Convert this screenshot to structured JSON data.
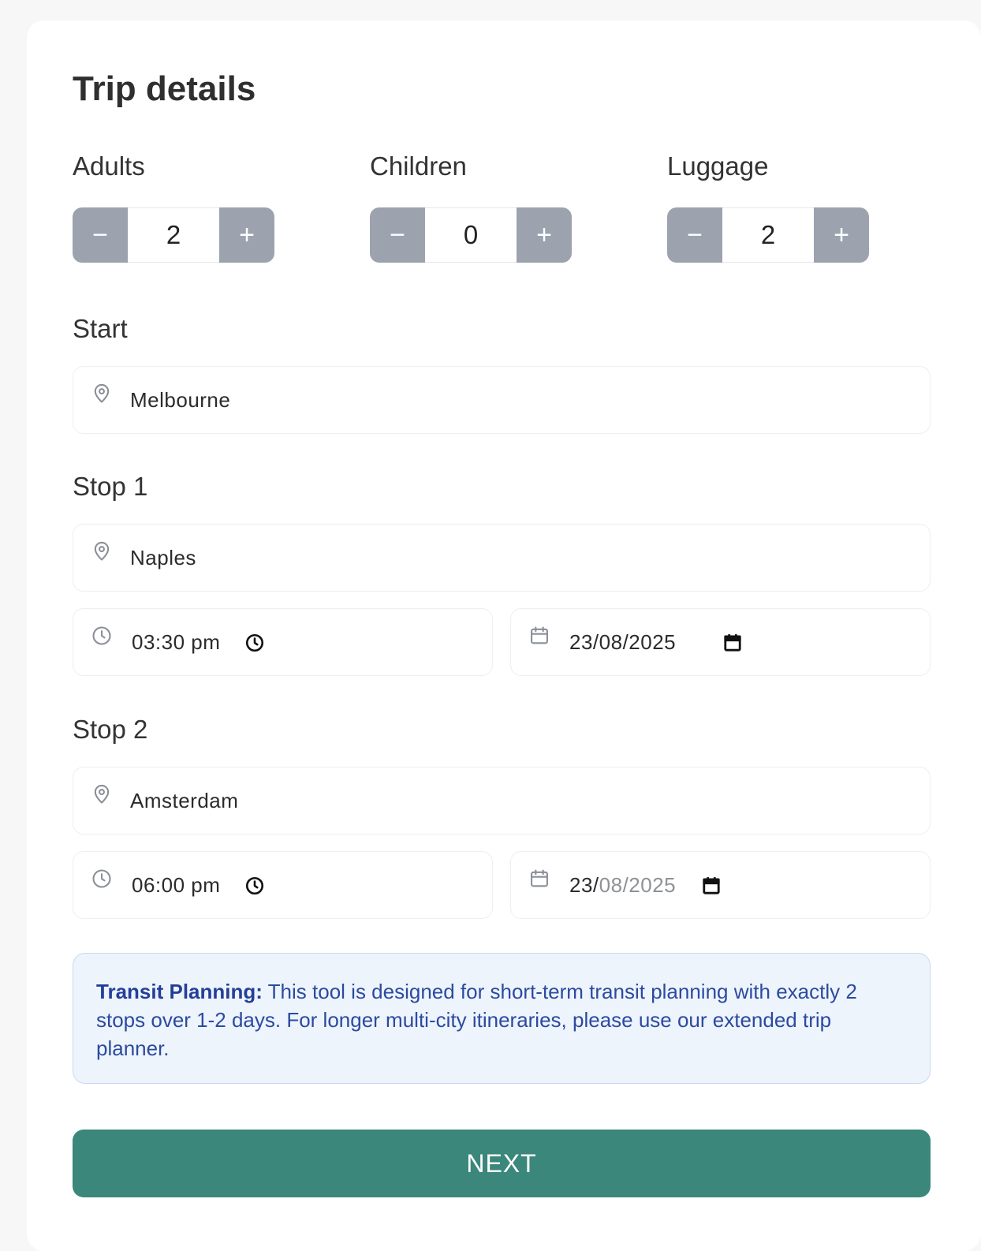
{
  "form": {
    "title": "Trip details",
    "counters": {
      "adults": {
        "label": "Adults",
        "value": "2",
        "decrement": "−",
        "increment": "+"
      },
      "children": {
        "label": "Children",
        "value": "0",
        "decrement": "−",
        "increment": "+"
      },
      "luggage": {
        "label": "Luggage",
        "value": "2",
        "decrement": "−",
        "increment": "+"
      }
    },
    "start": {
      "label": "Start",
      "location": "Melbourne"
    },
    "stop1": {
      "label": "Stop 1",
      "location": "Naples",
      "time": "03:30 pm",
      "date": "23/08/2025"
    },
    "stop2": {
      "label": "Stop 2",
      "location": "Amsterdam",
      "time": "06:00 pm",
      "date_day": "23/",
      "date_rest": "08/2025"
    },
    "notice": {
      "heading": "Transit Planning:",
      "body": " This tool is designed for short-term transit planning with exactly 2 stops over 1-2 days. For longer multi-city itineraries, please use our extended trip planner."
    },
    "next_label": "NEXT"
  },
  "colors": {
    "primary": "#3b877b",
    "stepper_button": "#9ca3af",
    "notice_bg": "#eef4fc",
    "notice_text": "#2b4aa0",
    "icon_gray": "#8a8f98"
  },
  "icons": {
    "location": "map-pin-icon",
    "time": "clock-icon",
    "date": "calendar-icon",
    "time_picker": "clock-picker-icon",
    "date_picker": "calendar-picker-icon"
  }
}
